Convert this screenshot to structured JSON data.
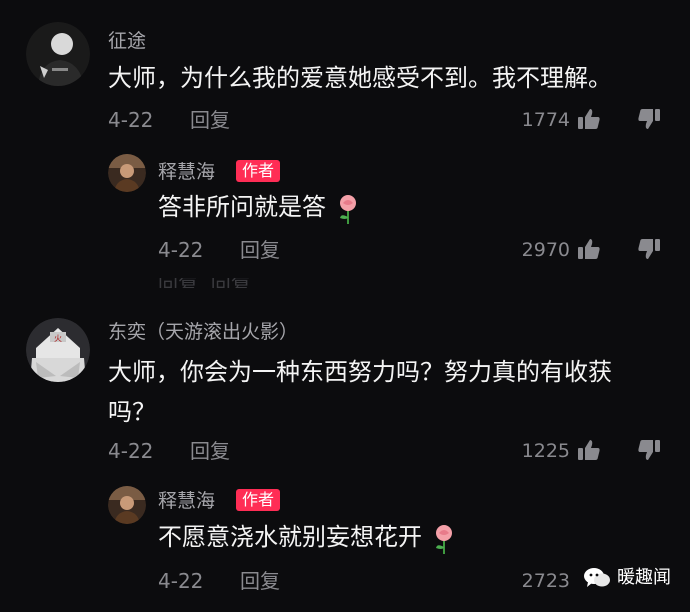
{
  "comments": [
    {
      "username": "征途",
      "text": "大师，为什么我的爱意她感受不到。我不理解。",
      "date": "4-22",
      "reply_label": "回复",
      "like_count": "1774",
      "reply": {
        "username": "释慧海",
        "badge": "作者",
        "text": "答非所问就是答",
        "date": "4-22",
        "reply_label": "回复",
        "like_count": "2970"
      }
    },
    {
      "username": "东奕（天游滚出火影）",
      "text": "大师，你会为一种东西努力吗？努力真的有收获吗？",
      "date": "4-22",
      "reply_label": "回复",
      "like_count": "1225",
      "reply": {
        "username": "释慧海",
        "badge": "作者",
        "text": "不愿意浇水就别妄想花开",
        "date": "4-22",
        "reply_label": "回复",
        "like_count": "2723"
      }
    }
  ],
  "ghost_text": "回复  回复",
  "watermark": {
    "text": "暖趣闻",
    "icon": "wechat-icon"
  },
  "colors": {
    "background": "#0c0c0e",
    "badge": "#ff2d55",
    "muted": "#8a8a8f",
    "text": "#f4f4f4"
  }
}
